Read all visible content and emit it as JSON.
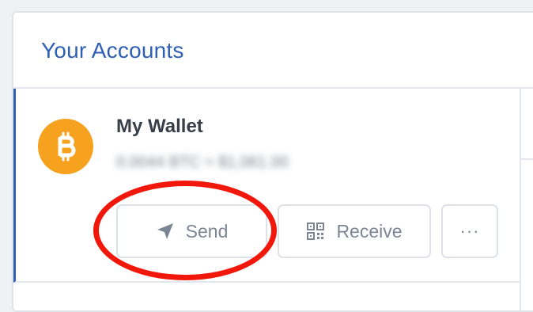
{
  "header": {
    "title": "Your Accounts"
  },
  "account": {
    "name": "My Wallet",
    "balance": "0.0044 BTC ≈ $1,061.00",
    "icon": "bitcoin-icon",
    "icon_color": "#f6a21f"
  },
  "actions": {
    "send_label": "Send",
    "send_icon": "send-arrow-icon",
    "receive_label": "Receive",
    "receive_icon": "qr-code-icon",
    "more_label": "···"
  },
  "annotation": {
    "highlight_color": "#f2170b",
    "highlight_target": "send-button"
  },
  "colors": {
    "accent": "#2d5fb3",
    "border": "#e3e8ee",
    "muted_text": "#7c8594"
  }
}
